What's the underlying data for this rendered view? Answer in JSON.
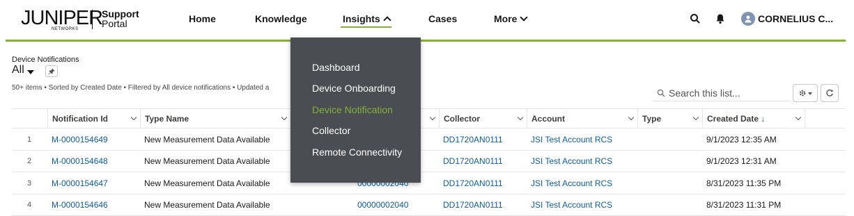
{
  "brand": {
    "logo_word": "JUNIPER",
    "logo_sub": "NETWORKS",
    "portal_line1": "Support",
    "portal_line2": "Portal"
  },
  "nav": {
    "home": "Home",
    "knowledge": "Knowledge",
    "insights": "Insights",
    "cases": "Cases",
    "more": "More"
  },
  "user": {
    "name": "CORNELIUS C..."
  },
  "list": {
    "object_label": "Device Notifications",
    "view_name": "All",
    "meta": "50+ items • Sorted by Created Date • Filtered by All device notifications • Updated a"
  },
  "search": {
    "placeholder": "Search this list..."
  },
  "table": {
    "columns": [
      "Notification Id",
      "Type Name",
      "",
      "Collector",
      "Account",
      "Type",
      "Created Date"
    ],
    "sort_arrow": "↓",
    "rows": [
      {
        "num": "1",
        "id": "M-0000154649",
        "type_name": "New Measurement Data Available",
        "device": "",
        "collector": "DD1720AN0111",
        "account": "JSI Test Account RCS",
        "type": "",
        "created": "9/1/2023 12:35 AM"
      },
      {
        "num": "2",
        "id": "M-0000154648",
        "type_name": "New Measurement Data Available",
        "device": "",
        "collector": "DD1720AN0111",
        "account": "JSI Test Account RCS",
        "type": "",
        "created": "9/1/2023 12:31 AM"
      },
      {
        "num": "3",
        "id": "M-0000154647",
        "type_name": "New Measurement Data Available",
        "device": "00000002040",
        "collector": "DD1720AN0111",
        "account": "JSI Test Account RCS",
        "type": "",
        "created": "8/31/2023 11:35 PM"
      },
      {
        "num": "4",
        "id": "M-0000154646",
        "type_name": "New Measurement Data Available",
        "device": "00000002040",
        "collector": "DD1720AN0111",
        "account": "JSI Test Account RCS",
        "type": "",
        "created": "8/31/2023 11:31 PM"
      }
    ]
  },
  "insights_menu": {
    "items": [
      "Dashboard",
      "Device Onboarding",
      "Device Notification",
      "Collector",
      "Remote Connectivity"
    ],
    "active_index": 2
  },
  "colors": {
    "accent_green": "#84b135",
    "link_blue": "#0b5cab",
    "menu_bg": "#4a4d51"
  }
}
